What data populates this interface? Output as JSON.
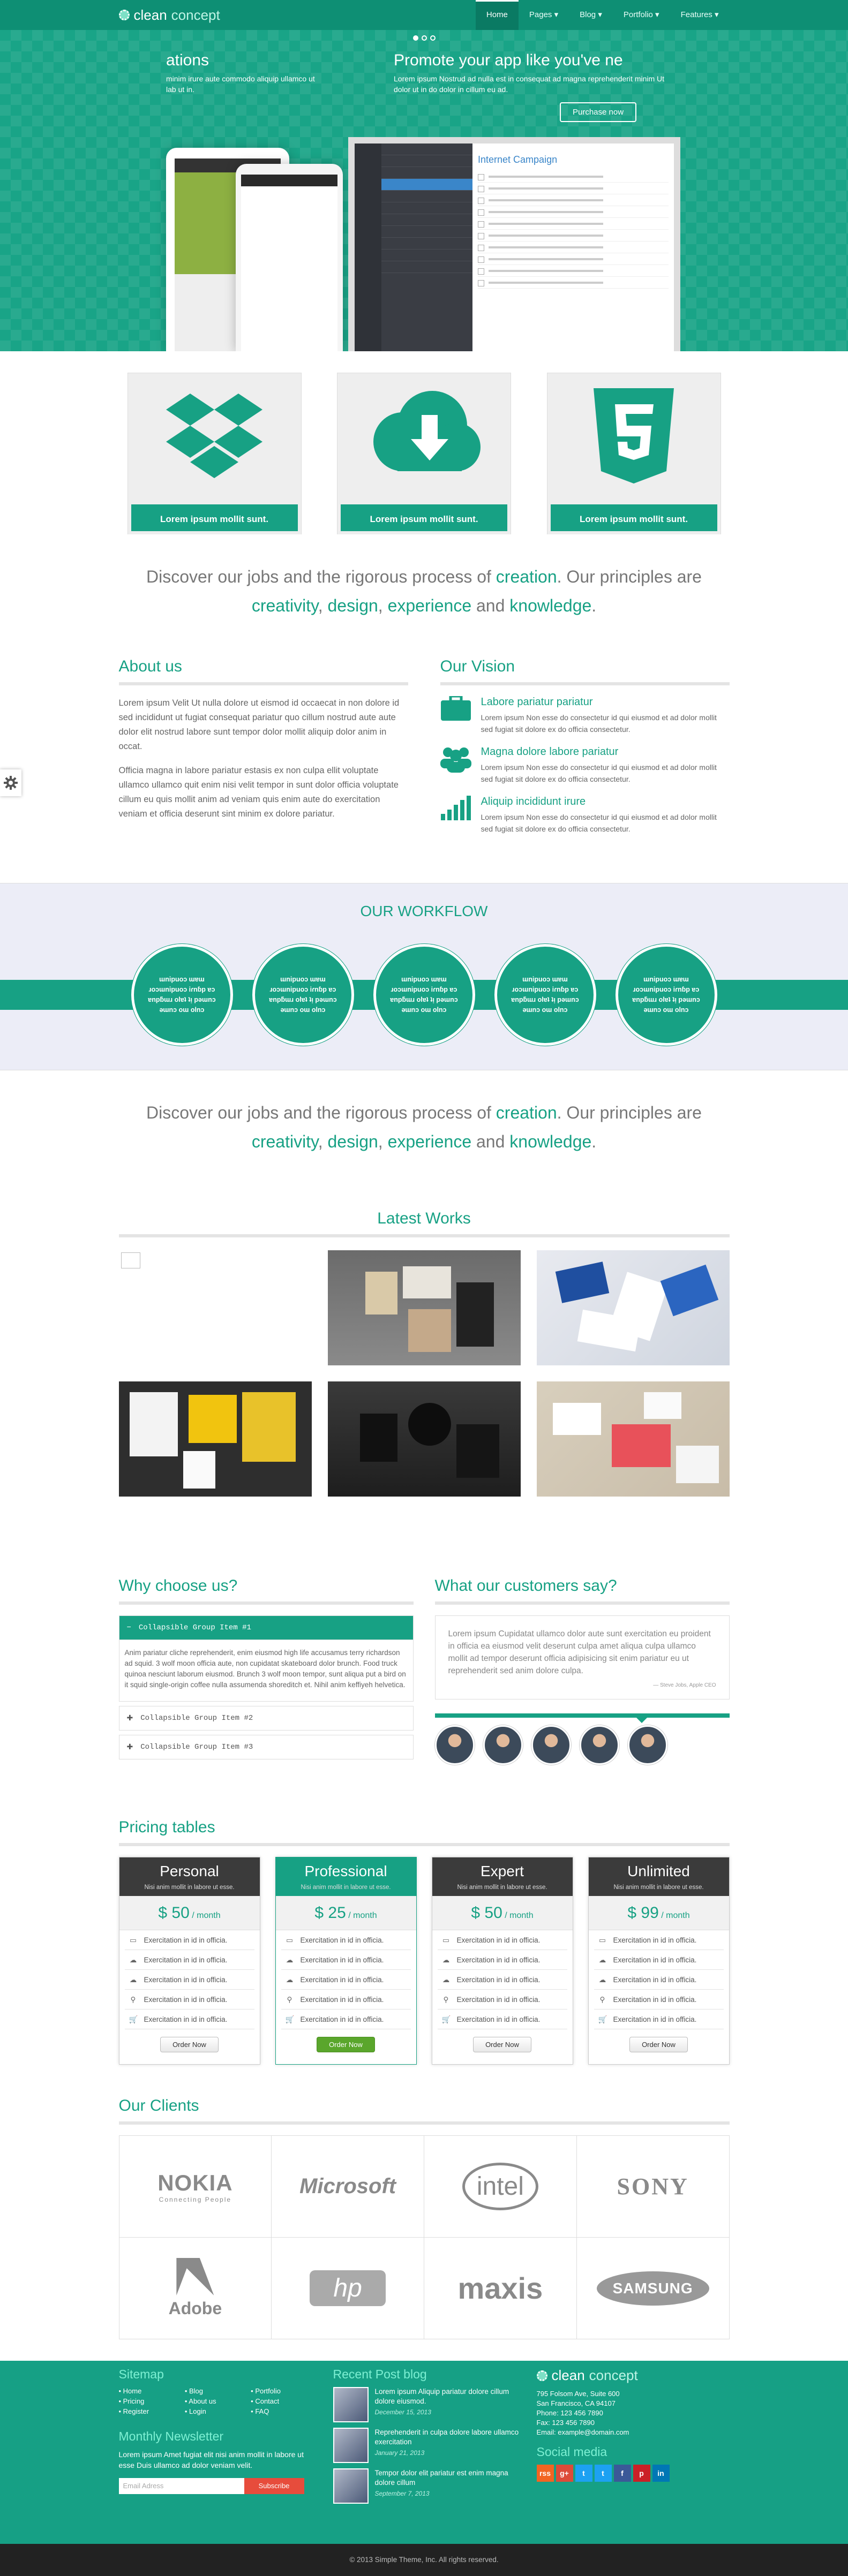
{
  "nav": {
    "brand": "clean",
    "brand2": "concept",
    "items": [
      "Home",
      "Pages",
      "Blog",
      "Portfolio",
      "Features"
    ]
  },
  "hero": {
    "left_title": "ations",
    "left_text": "minim irure aute commodo aliquip ullamco ut lab ut in.",
    "right_title": "Promote your app like you've ne",
    "right_text": "Lorem ipsum Nostrud ad nulla est in consequat ad magna reprehenderit minim Ut dolor ut in do dolor in cillum eu ad.",
    "button": "Purchase now",
    "laptop_heading": "Internet Campaign"
  },
  "features": [
    {
      "label": "Lorem ipsum mollit sunt.",
      "icon": "dropbox-icon"
    },
    {
      "label": "Lorem ipsum mollit sunt.",
      "icon": "cloud-download-icon"
    },
    {
      "label": "Lorem ipsum mollit sunt.",
      "icon": "html5-icon"
    }
  ],
  "tagline": {
    "a": "Discover our jobs and the rigorous process of ",
    "b": "creation",
    "c": ". Our principles are",
    "d": "creativity",
    "e": ", ",
    "f": "design",
    "g": ", ",
    "h": "experience",
    "i": " and ",
    "j": "knowledge",
    "k": "."
  },
  "about": {
    "title": "About us",
    "p1": "Lorem ipsum Velit Ut nulla dolore ut eismod id occaecat in non dolore id sed incididunt ut fugiat consequat pariatur quo cillum nostrud aute aute dolor elit nostrud labore sunt tempor dolor mollit aliquip dolor anim in occat.",
    "p2": "Officia magna in labore pariatur estasis ex non culpa ellit voluptate ullamco ullamco quit enim nisi velit tempor in sunt dolor officia voluptate cillum eu quis mollit anim ad veniam quis enim aute do exercitation veniam et officia deserunt sint minim ex dolore pariatur."
  },
  "vision": {
    "title": "Our Vision",
    "items": [
      {
        "title": "Labore pariatur pariatur",
        "text": "Lorem ipsum Non esse do consectetur id qui eiusmod et ad dolor mollit sed fugiat sit dolore ex do officia consectetur."
      },
      {
        "title": "Magna dolore labore pariatur",
        "text": "Lorem ipsum Non esse do consectetur id qui eiusmod et ad dolor mollit sed fugiat sit dolore ex do officia consectetur."
      },
      {
        "title": "Aliquip incididunt irure",
        "text": "Lorem ipsum Non esse do consectetur id qui eiusmod et ad dolor mollit sed fugiat sit dolore ex do officia consectetur."
      }
    ]
  },
  "workflow": {
    "title": "OUR WORKFLOW",
    "steps": [
      "ɯnipuoɔ ɯɐɯ ɹoɔ‌ɯnipuoɔ iɾnɓp ɐɔ ɐnpƃɯɹ olɐʇ ʇᴉ pǝɯnɔ ǝɯnɔ oɯ olnɔ",
      "ɯnipuoɔ ɯɐɯ ɹoɔ‌ɯnipuoɔ iɾnɓp ɐɔ ɐnpƃɯɹ olɐʇ ʇᴉ pǝɯnɔ ǝɯnɔ oɯ olnɔ",
      "ɯnipuoɔ ɯɐɯ ɹoɔ‌ɯnipuoɔ iɾnɓp ɐɔ ɐnpƃɯɹ olɐʇ ʇᴉ pǝɯnɔ ǝɯnɔ oɯ olnɔ",
      "ɯnipuoɔ ɯɐɯ ɹoɔ‌ɯnipuoɔ iɾnɓp ɐɔ ɐnpƃɯɹ olɐʇ ʇᴉ pǝɯnɔ ǝɯnɔ oɯ olnɔ",
      "ɯnipuoɔ ɯɐɯ ɹoɔ‌ɯnipuoɔ iɾnɓp ɐɔ ɐnpƃɯɹ olɐʇ ʇᴉ pǝɯnɔ ǝɯnɔ oɯ olnɔ"
    ]
  },
  "works": {
    "title": "Latest Works"
  },
  "why": {
    "title": "Why choose us?",
    "groups": [
      "Collapsible Group Item #1",
      "Collapsible Group Item #2",
      "Collapsible Group Item #3"
    ],
    "open_text": "Anim pariatur cliche reprehenderit, enim eiusmod high life accusamus terry richardson ad squid. 3 wolf moon officia aute, non cupidatat skateboard dolor brunch. Food truck quinoa nesciunt laborum eiusmod. Brunch 3 wolf moon tempor, sunt aliqua put a bird on it squid single-origin coffee nulla assumenda shoreditch et. Nihil anim keffiyeh helvetica."
  },
  "customers": {
    "title": "What our customers say?",
    "quote": "Lorem ipsum Cupidatat ullamco dolor aute sunt exercitation eu proident in officia ea eiusmod velit deserunt culpa amet aliqua culpa ullamco mollit ad tempor deserunt officia adipisicing sit enim pariatur eu ut reprehenderit sed anim dolore culpa.",
    "author": "— Steve Jobs, Apple CEO"
  },
  "pricing": {
    "title": "Pricing tables",
    "plans": [
      {
        "name": "Personal",
        "sub": "Nisi anim mollit in labore ut esse.",
        "price": "$ 50",
        "per": " / month",
        "button": "Order Now"
      },
      {
        "name": "Professional",
        "sub": "Nisi anim mollit in labore ut esse.",
        "price": "$ 25",
        "per": " / month",
        "button": "Order Now"
      },
      {
        "name": "Expert",
        "sub": "Nisi anim mollit in labore ut esse.",
        "price": "$ 50",
        "per": " / month",
        "button": "Order Now"
      },
      {
        "name": "Unlimited",
        "sub": "Nisi anim mollit in labore ut esse.",
        "price": "$ 99",
        "per": " / month",
        "button": "Order Now"
      }
    ],
    "feature": "Exercitation in id in officia."
  },
  "clients": {
    "title": "Our Clients",
    "logos": [
      "NOKIA",
      "Connecting People",
      "Microsoft",
      "intel",
      "SONY",
      "Adobe",
      "hp",
      "maxis",
      "SAMSUNG"
    ]
  },
  "footer": {
    "sitemap_title": "Sitemap",
    "links": [
      "Home",
      "Blog",
      "Portfolio",
      "Pricing",
      "About us",
      "Contact",
      "Register",
      "Login",
      "FAQ"
    ],
    "newsletter_title": "Monthly Newsletter",
    "newsletter_text": "Lorem ipsum Amet fugiat elit nisi anim mollit in labore ut esse Duis ullamco ad dolor veniam velit.",
    "email_placeholder": "Email Adress",
    "subscribe": "Subscribe",
    "blog_title": "Recent Post blog",
    "posts": [
      {
        "title": "Lorem ipsum Aliquip pariatur dolore cillum dolore eiusmod.",
        "date": "December 15, 2013"
      },
      {
        "title": "Reprehenderit in culpa dolore labore ullamco exercitation",
        "date": "January 21, 2013"
      },
      {
        "title": "Tempor dolor elit pariatur est enim magna dolore cillum",
        "date": "September 7, 2013"
      }
    ],
    "brand": "clean",
    "brand2": "concept",
    "address": [
      "795 Folsom Ave, Suite 600",
      "San Francisco, CA 94107",
      "Phone: 123 456 7890",
      "Fax: 123 456 7890",
      "Email: example@domain.com"
    ],
    "social_title": "Social media",
    "social": [
      "rss",
      "g+",
      "t",
      "t",
      "f",
      "p",
      "in"
    ],
    "copyright": "© 2013 Simple Theme, Inc. All rights reserved."
  },
  "colors": {
    "accent": "#17a184",
    "footer": "#16a085",
    "bottom": "#222222",
    "order_green": "#5aa62c",
    "subscribe_red": "#e74c3c"
  }
}
